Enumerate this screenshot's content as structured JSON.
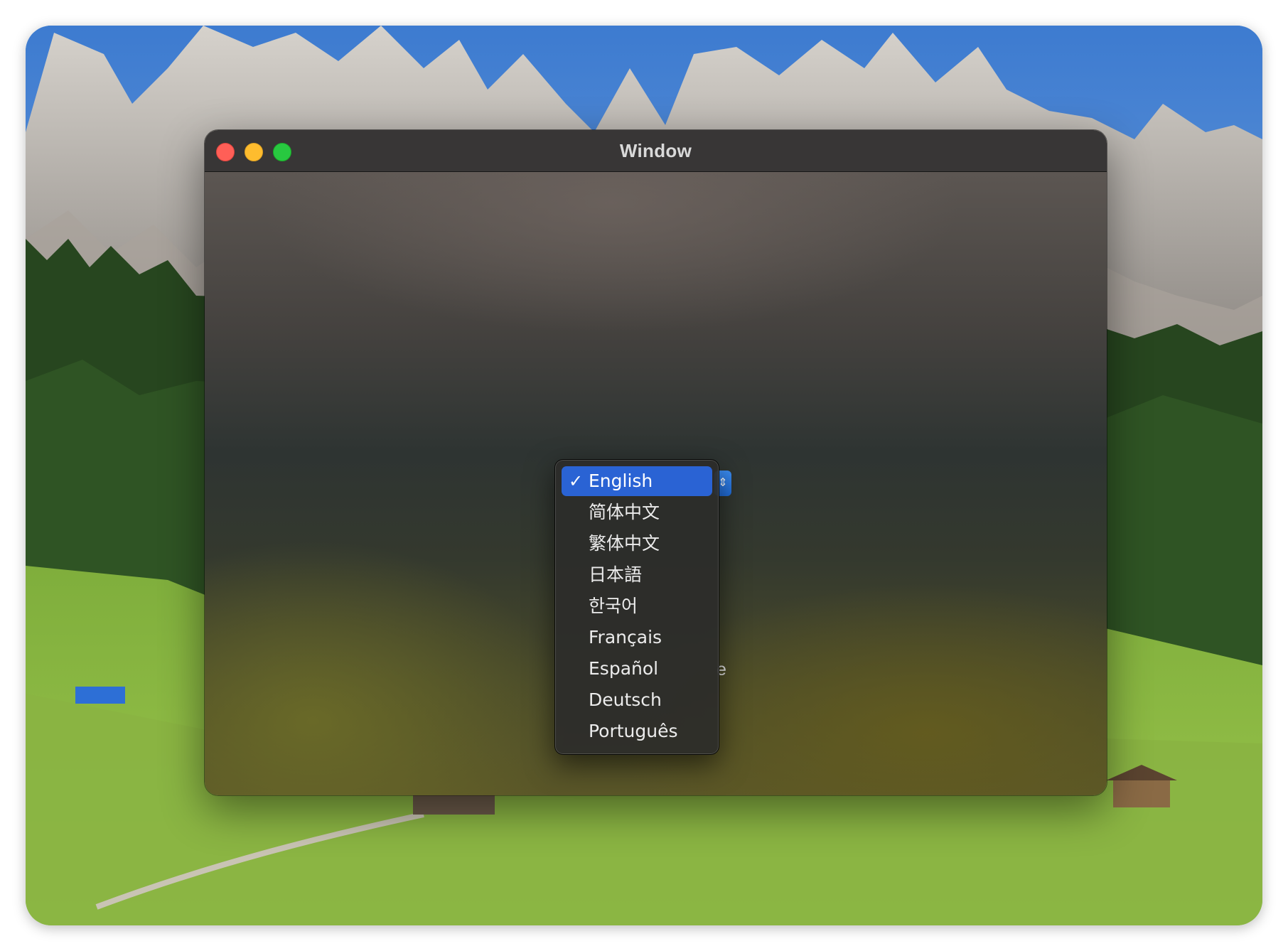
{
  "window": {
    "title": "Window"
  },
  "menu": {
    "selected_index": 0,
    "check_glyph": "✓",
    "items": [
      {
        "label": "English"
      },
      {
        "label": "简体中文"
      },
      {
        "label": "繁体中文"
      },
      {
        "label": "日本語"
      },
      {
        "label": "한국어"
      },
      {
        "label": "Français"
      },
      {
        "label": "Español"
      },
      {
        "label": "Deutsch"
      },
      {
        "label": "Português"
      }
    ]
  },
  "popup": {
    "stepper_glyph": "⇕",
    "partial_label": "e"
  },
  "colors": {
    "selection": "#2a63d4",
    "close": "#ff5f57",
    "minimize": "#febc2e",
    "maximize": "#28c840"
  }
}
